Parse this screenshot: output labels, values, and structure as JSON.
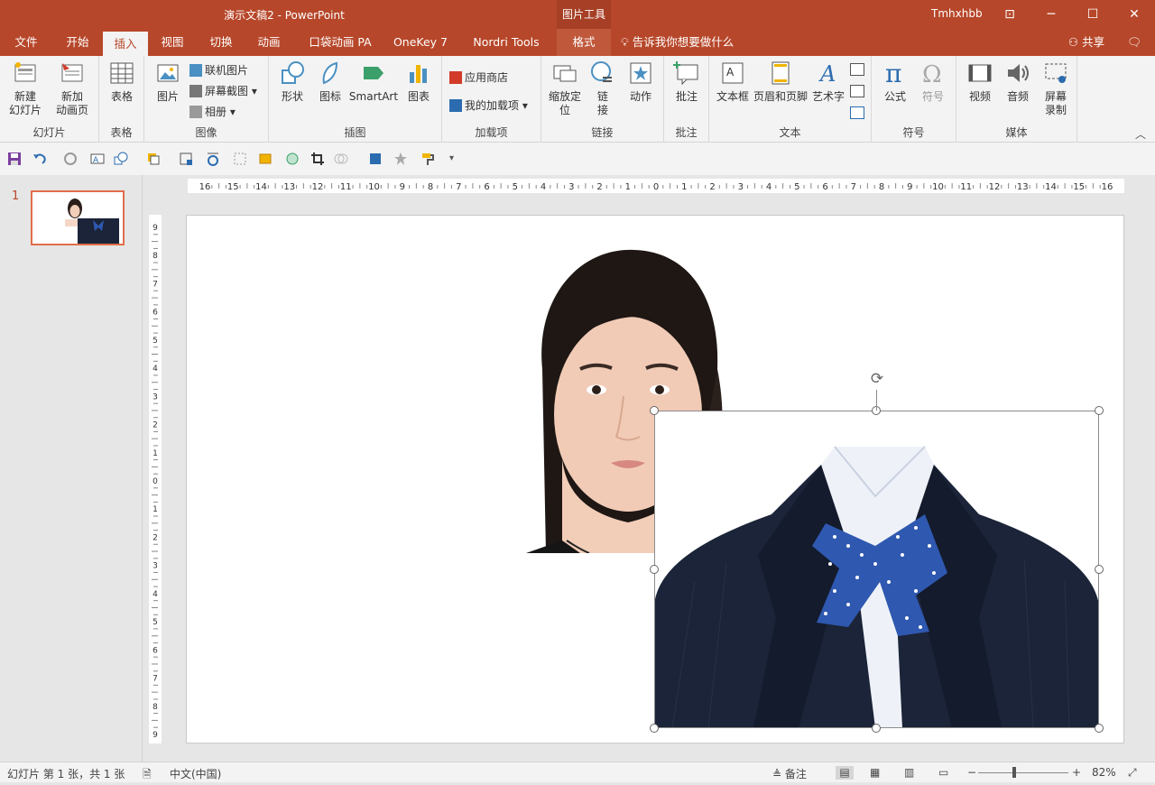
{
  "window": {
    "title": "演示文稿2  -  PowerPoint",
    "context_tab": "图片工具",
    "user": "Tmhxhbb"
  },
  "tabs": [
    {
      "label": "文件"
    },
    {
      "label": "开始"
    },
    {
      "label": "插入"
    },
    {
      "label": "视图"
    },
    {
      "label": "切换"
    },
    {
      "label": "动画"
    },
    {
      "label": "口袋动画 PA"
    },
    {
      "label": "OneKey 7"
    },
    {
      "label": "Nordri Tools"
    },
    {
      "label": "格式"
    }
  ],
  "tellme": "告诉我你想要做什么",
  "share": "共享",
  "ribbon": {
    "slides": {
      "label": "幻灯片",
      "new_slide": "新建\n幻灯片",
      "new_anim": "新加\n动画页"
    },
    "table": {
      "label": "表格",
      "table": "表格"
    },
    "images": {
      "label": "图像",
      "picture": "图片",
      "online": "联机图片",
      "screenshot": "屏幕截图",
      "album": "相册"
    },
    "illustrations": {
      "label": "插图",
      "shapes": "形状",
      "icons": "图标",
      "smartart": "SmartArt",
      "chart": "图表"
    },
    "addins": {
      "label": "加载项",
      "store": "应用商店",
      "my_addins": "我的加载项"
    },
    "links": {
      "label": "链接",
      "zoom": "缩放定\n位",
      "link": "链\n接",
      "action": "动作"
    },
    "comments": {
      "label": "批注",
      "comment": "批注"
    },
    "text": {
      "label": "文本",
      "textbox": "文本框",
      "header_footer": "页眉和页脚",
      "wordart": "艺术字"
    },
    "symbols": {
      "label": "符号",
      "equation": "公式",
      "symbol": "符号"
    },
    "media": {
      "label": "媒体",
      "video": "视频",
      "audio": "音频",
      "screen_rec": "屏幕\n录制"
    }
  },
  "thumbnail": {
    "number": "1"
  },
  "ruler": {
    "h_labels": [
      "16",
      "15",
      "14",
      "13",
      "12",
      "11",
      "10",
      "9",
      "8",
      "7",
      "6",
      "5",
      "4",
      "3",
      "2",
      "1",
      "0",
      "1",
      "2",
      "3",
      "4",
      "5",
      "6",
      "7",
      "8",
      "9",
      "10",
      "11",
      "12",
      "13",
      "14",
      "15",
      "16"
    ],
    "v_labels": [
      "9",
      "8",
      "7",
      "6",
      "5",
      "4",
      "3",
      "2",
      "1",
      "0",
      "1",
      "2",
      "3",
      "4",
      "5",
      "6",
      "7",
      "8",
      "9"
    ]
  },
  "status": {
    "slide_info": "幻灯片 第 1 张，共 1 张",
    "language": "中文(中国)",
    "notes": "备注",
    "zoom": "82%"
  },
  "colors": {
    "brand": "#b7472a",
    "selection_handle": "#666666"
  }
}
